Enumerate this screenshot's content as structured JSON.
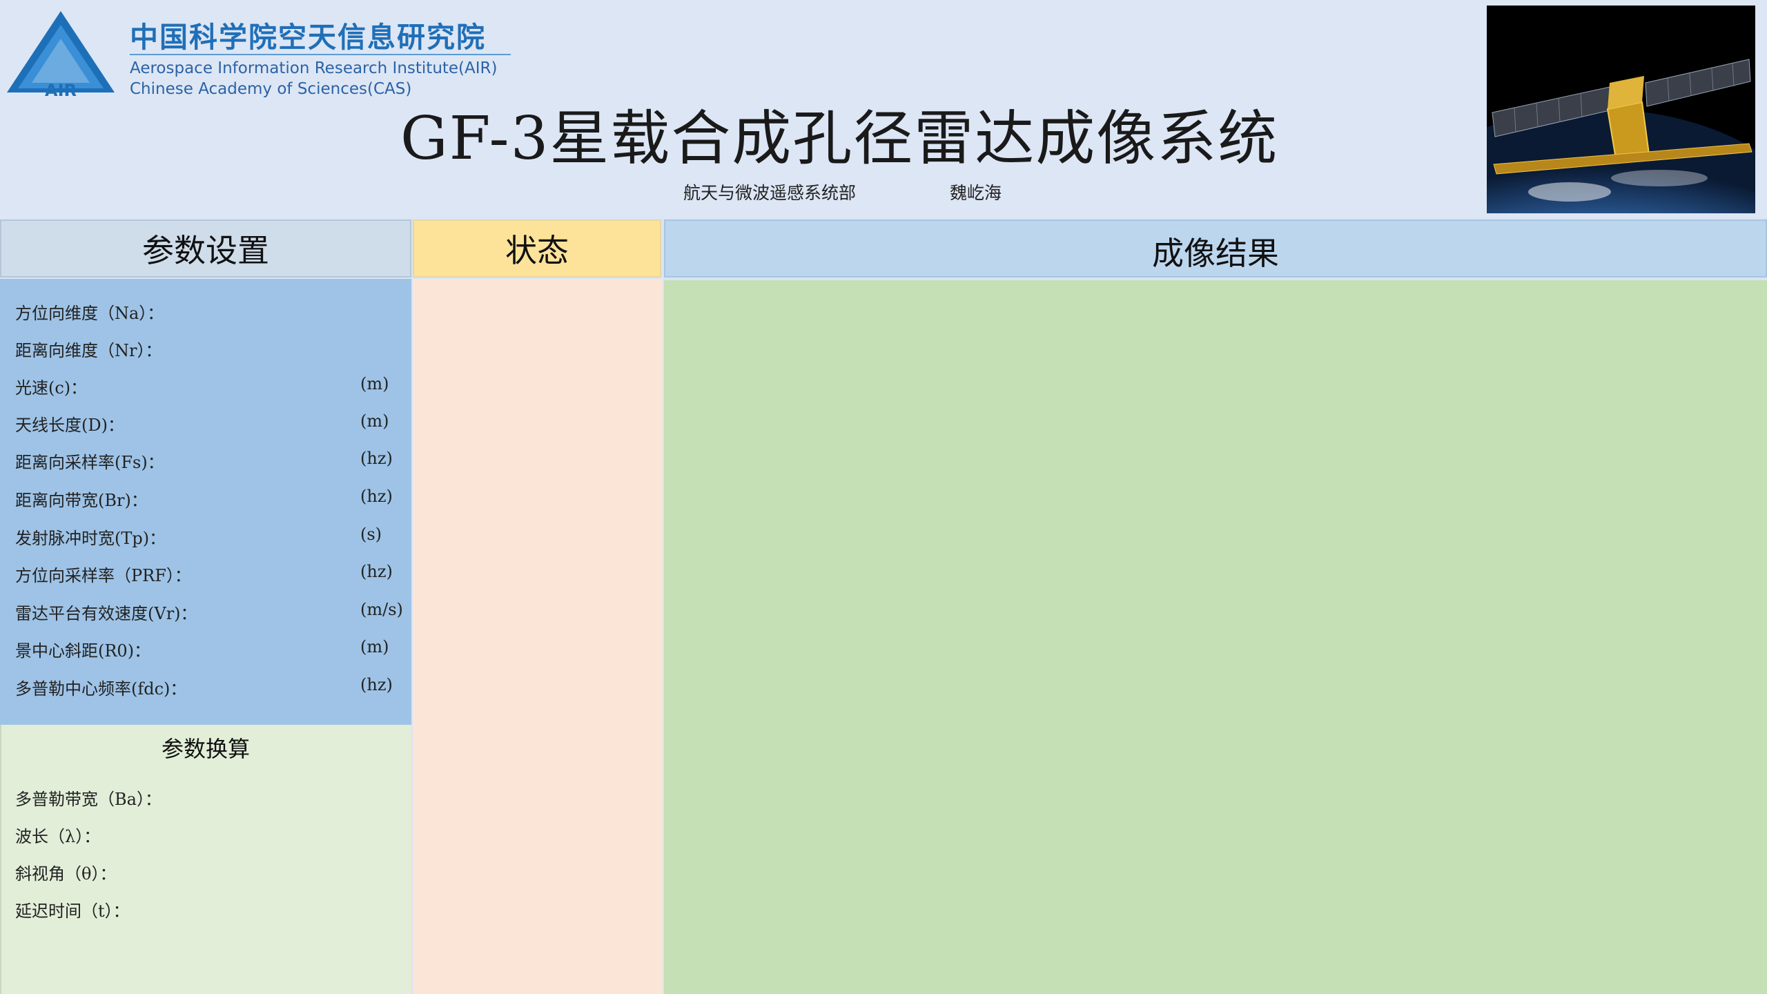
{
  "header": {
    "logo_text": "AIR",
    "org_name_cn": "中国科学院空天信息研究院",
    "org_name_en_1": "Aerospace Information Research Institute(AIR)",
    "org_name_en_2": "Chinese Academy of Sciences(CAS)",
    "main_title": "GF-3星载合成孔径雷达成像系统",
    "department": "航天与微波遥感系统部",
    "author": "魏屹海"
  },
  "columns": {
    "params_title": "参数设置",
    "status_title": "状态",
    "result_title": "成像结果"
  },
  "params": [
    {
      "label": "方位向维度（Na）：",
      "unit": ""
    },
    {
      "label": "距离向维度（Nr）：",
      "unit": ""
    },
    {
      "label": "光速(c)：",
      "unit": "(m)"
    },
    {
      "label": "天线长度(D)：",
      "unit": "(m)"
    },
    {
      "label": "距离向采样率(Fs)：",
      "unit": "(hz)"
    },
    {
      "label": "距离向带宽(Br)：",
      "unit": "(hz)"
    },
    {
      "label": "发射脉冲时宽(Tp)：",
      "unit": "(s)"
    },
    {
      "label": "方位向采样率（PRF）：",
      "unit": "(hz)"
    },
    {
      "label": "雷达平台有效速度(Vr)：",
      "unit": "(m/s)"
    },
    {
      "label": "景中心斜距(R0)：",
      "unit": "(m)"
    },
    {
      "label": "多普勒中心频率(fdc)：",
      "unit": "(hz)"
    }
  ],
  "conversion": {
    "title": "参数换算",
    "items": [
      "多普勒带宽（Ba）：",
      "波长（λ）：",
      "斜视角（θ）：",
      "延迟时间（t）："
    ]
  },
  "colors": {
    "header_bg": "#dde6f5",
    "params_panel": "#9ec3e6",
    "status_panel": "#fbe5d6",
    "result_panel": "#c5e0b4",
    "conversion_panel": "#e2eed8",
    "logo_blue": "#1f6fb8"
  }
}
